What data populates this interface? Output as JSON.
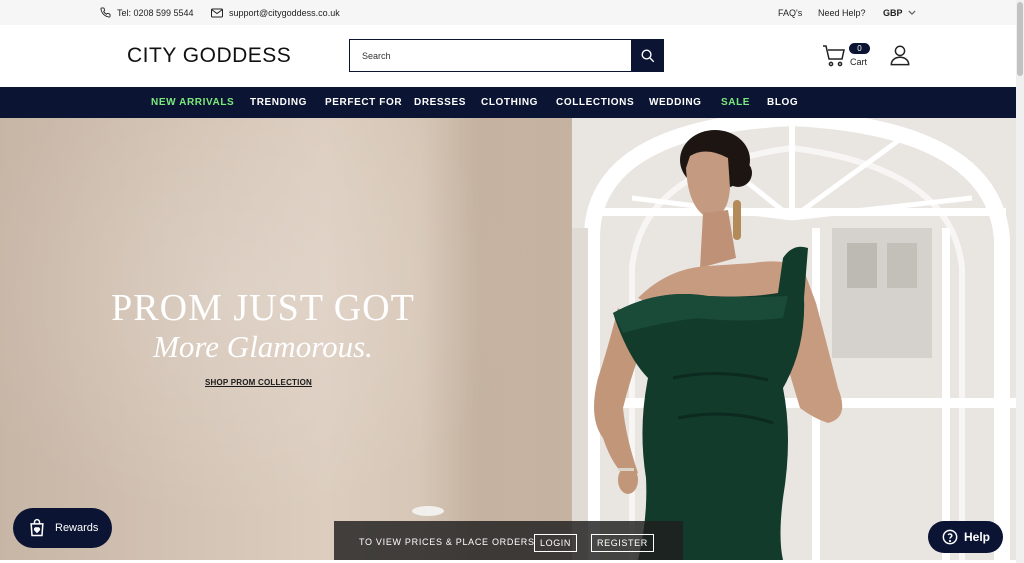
{
  "topbar": {
    "phone": "Tel: 0208 599 5544",
    "email": "support@citygoddess.co.uk",
    "faq": "FAQ's",
    "help": "Need Help?",
    "currency": "GBP"
  },
  "header": {
    "logo": "CITY GODDESS",
    "search_placeholder": "Search",
    "cart_count": "0",
    "cart_label": "Cart"
  },
  "nav": {
    "items": [
      "NEW ARRIVALS",
      "TRENDING",
      "PERFECT FOR",
      "DRESSES",
      "CLOTHING",
      "COLLECTIONS",
      "WEDDING",
      "SALE",
      "BLOG"
    ],
    "highlight_color": "#7bea7c"
  },
  "hero": {
    "title": "PROM JUST GOT",
    "subtitle": "More Glamorous.",
    "cta": "SHOP PROM COLLECTION"
  },
  "widgets": {
    "rewards": "Rewards",
    "help": "Help"
  },
  "login_banner": {
    "message": "TO VIEW PRICES & PLACE ORDERS",
    "login": "LOGIN",
    "register": "REGISTER"
  },
  "colors": {
    "navy": "#0b1533",
    "dress": "#123b2c"
  },
  "icons": [
    "phone-icon",
    "mail-icon",
    "chevron-down-icon",
    "search-icon",
    "cart-icon",
    "user-icon",
    "rewards-bag-icon",
    "help-question-icon"
  ]
}
